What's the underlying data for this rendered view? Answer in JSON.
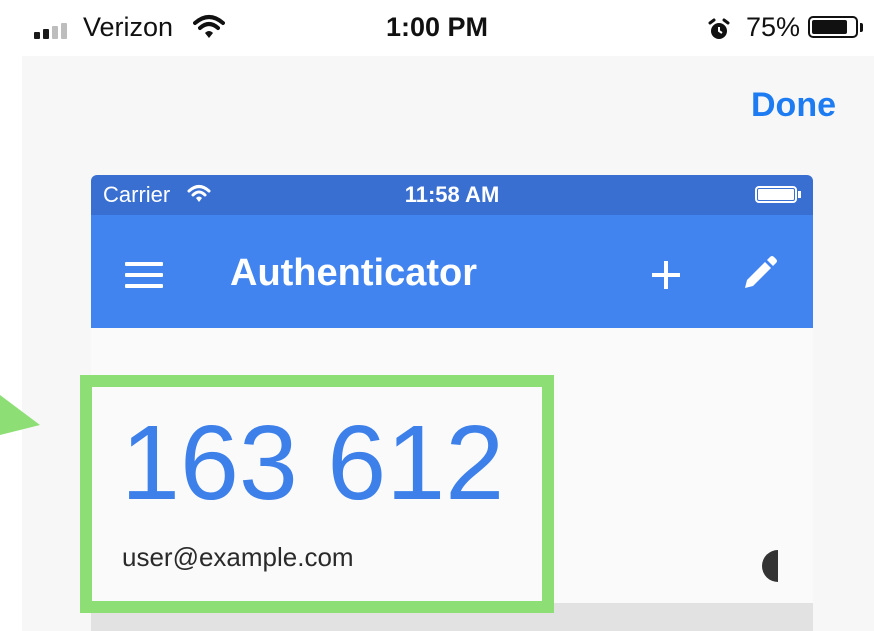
{
  "outer_status": {
    "carrier": "Verizon",
    "time": "1:00 PM",
    "battery_percent": "75%",
    "battery_level": 0.75,
    "icons": [
      "signal-icon",
      "wifi-icon",
      "alarm-icon",
      "battery-icon"
    ]
  },
  "sheet": {
    "done_label": "Done",
    "accent_color": "#1e7cf2"
  },
  "inner_phone": {
    "status": {
      "carrier": "Carrier",
      "time": "11:58 AM",
      "icons": [
        "wifi-icon",
        "battery-icon"
      ]
    },
    "appbar": {
      "title": "Authenticator",
      "color": "#4184f0",
      "icons": [
        "menu-icon",
        "plus-icon",
        "pencil-icon"
      ]
    },
    "entry": {
      "code": "163 612",
      "account": "user@example.com",
      "code_color": "#3d80ea",
      "icons": [
        "timer-icon"
      ]
    }
  },
  "annotation": {
    "highlight_color": "#8ddf75",
    "icons": [
      "arrow-pointer-icon"
    ]
  }
}
